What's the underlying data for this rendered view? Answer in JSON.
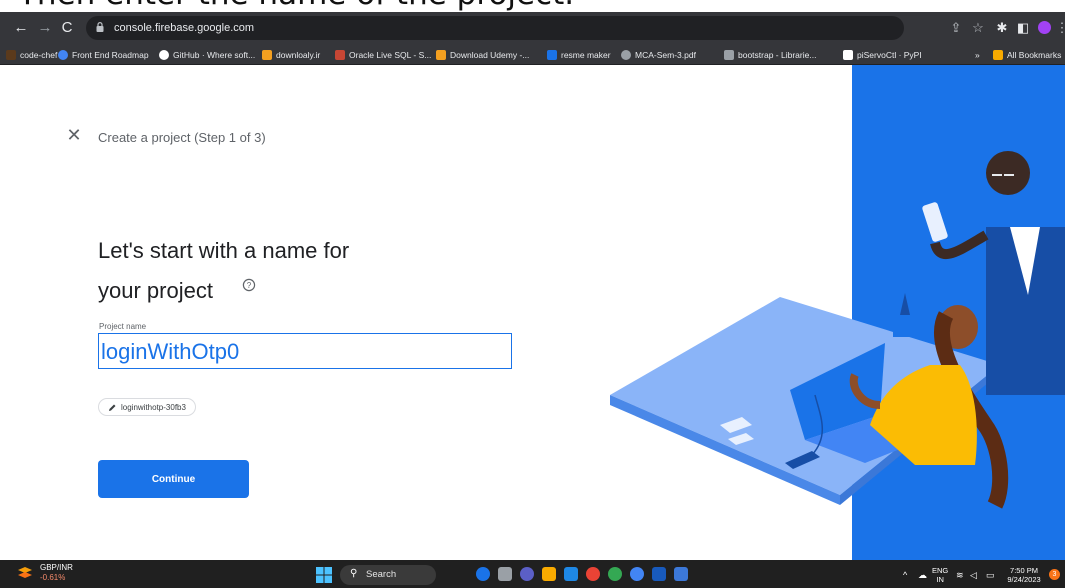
{
  "caption": {
    "text": "Then enter the name of the project."
  },
  "browser": {
    "url": "console.firebase.google.com",
    "bookmarks": [
      {
        "label": "code-chef",
        "color": "#5b3a1c"
      },
      {
        "label": "Front End Roadmap",
        "color": "#4285f4"
      },
      {
        "label": "GitHub · Where soft...",
        "color": "#ffffff"
      },
      {
        "label": "downloaly.ir",
        "color": "#f4a020"
      },
      {
        "label": "Oracle Live SQL - S...",
        "color": "#c74634"
      },
      {
        "label": "Download Udemy -...",
        "color": "#f4a020"
      },
      {
        "label": "resme maker",
        "color": "#1a73e8"
      },
      {
        "label": "MCA-Sem-3.pdf",
        "color": "#9aa0a6"
      },
      {
        "label": "bootstrap - Librarie...",
        "color": "#9aa0a6"
      },
      {
        "label": "piServoCtl · PyPI",
        "color": "#ffffff"
      }
    ],
    "overflow": "»",
    "all_bookmarks": "All Bookmarks"
  },
  "firebase": {
    "step_label": "Create a project (Step 1 of 3)",
    "headline_line1": "Let's start with a name for",
    "headline_line2": "your project",
    "field_label": "Project name",
    "project_name": "loginWithOtp0",
    "project_id": "loginwithotp-30fb3",
    "continue_label": "Continue"
  },
  "taskbar": {
    "stock_title": "GBP/INR",
    "stock_change": "-0.61%",
    "search_label": "Search",
    "lang_top": "ENG",
    "lang_bottom": "IN",
    "time": "7:50 PM",
    "date": "9/24/2023",
    "notifications": "3"
  },
  "colors": {
    "brand_blue": "#1a73e8",
    "chrome_dark": "#35363a"
  }
}
